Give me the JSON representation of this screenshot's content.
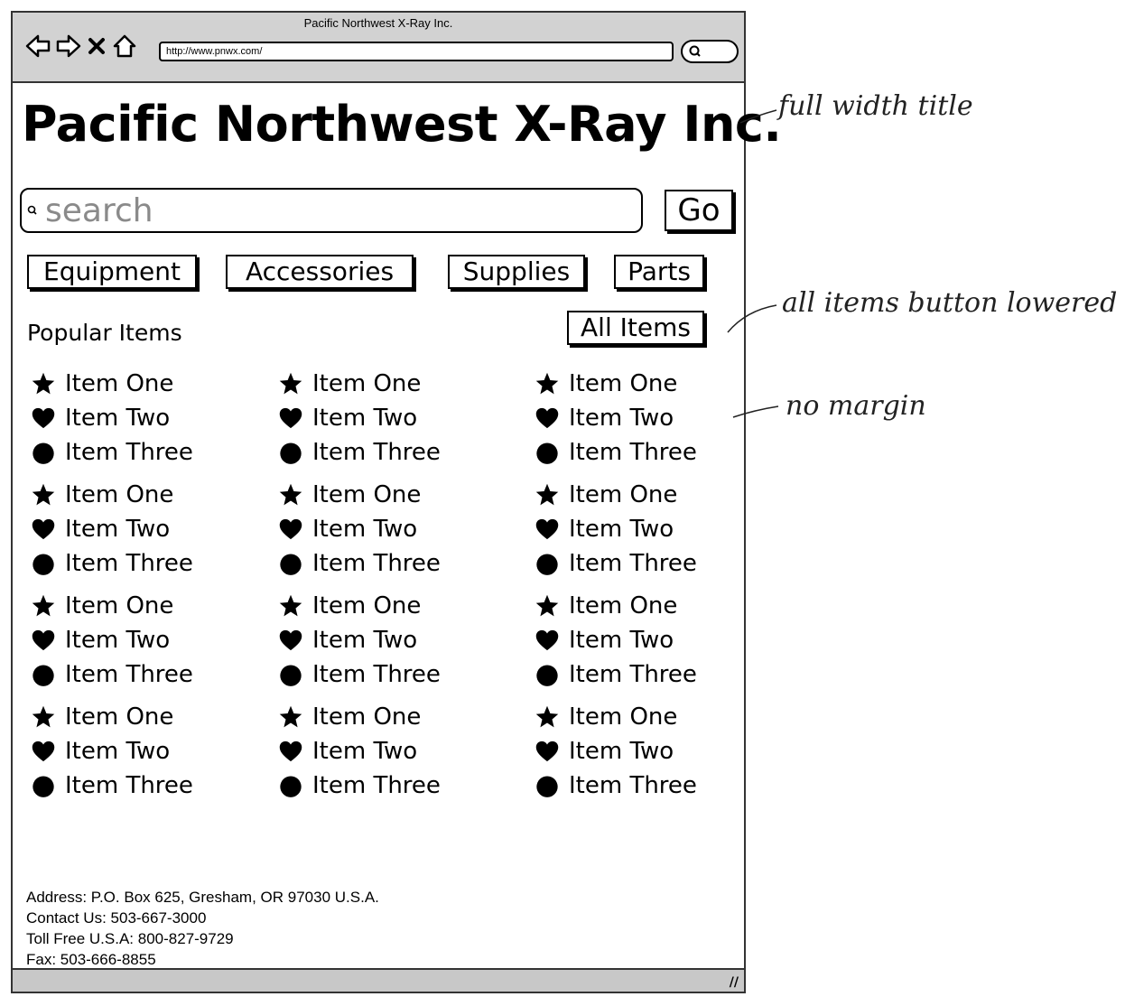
{
  "window": {
    "title": "Pacific Northwest X-Ray Inc.",
    "url": "http://www.pnwx.com/"
  },
  "page": {
    "title": "Pacific Northwest X-Ray Inc.",
    "search_placeholder": "search",
    "go_label": "Go",
    "categories": [
      "Equipment",
      "Accessories",
      "Supplies",
      "Parts"
    ],
    "popular_label": "Popular Items",
    "all_items_label": "All Items"
  },
  "items": {
    "one": "Item One",
    "two": "Item Two",
    "three": "Item Three"
  },
  "icons": [
    "star-icon",
    "heart-icon",
    "circle-icon"
  ],
  "footer": {
    "address": "Address: P.O. Box 625, Gresham, OR 97030 U.S.A.",
    "contact": "Contact Us: 503-667-3000",
    "tollfree": "Toll Free U.S.A: 800-827-9729",
    "fax": "Fax: 503-666-8855"
  },
  "annotations": {
    "title_note": "full width title",
    "button_note": "all items button lowered",
    "margin_note": "no margin"
  }
}
